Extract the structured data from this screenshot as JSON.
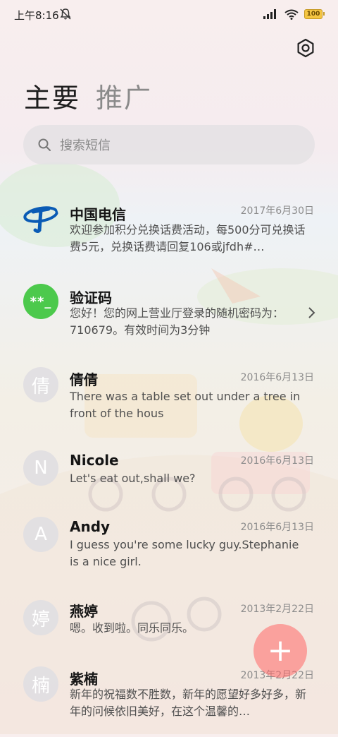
{
  "status_bar": {
    "time": "上午8:16",
    "battery": "100",
    "icons": [
      "bell-off-icon",
      "signal-icon",
      "wifi-icon",
      "battery-icon"
    ]
  },
  "header": {
    "settings_icon": "gear-icon",
    "tabs": [
      {
        "label": "主要",
        "active": true
      },
      {
        "label": "推广",
        "active": false
      }
    ]
  },
  "search": {
    "placeholder": "搜索短信",
    "icon": "search-icon"
  },
  "conversations": [
    {
      "sender": "中国电信",
      "date": "2017年6月30日",
      "preview": "欢迎参加积分兑换话费活动，每500分可兑换话费5元，兑换话费请回复106或jfdh#…",
      "avatar": "china-telecom-logo"
    },
    {
      "sender": "验证码",
      "date": "",
      "preview": "您好！您的网上营业厅登录的随机密码为：710679。有效时间为3分钟",
      "avatar_text": "**_"
    },
    {
      "sender": "倩倩",
      "date": "2016年6月13日",
      "preview": "There was a table set out under a tree in front of the hous",
      "avatar_text": "倩"
    },
    {
      "sender": "Nicole",
      "date": "2016年6月13日",
      "preview": "Let's eat out,shall we?",
      "avatar_text": "N"
    },
    {
      "sender": "Andy",
      "date": "2016年6月13日",
      "preview": "I guess you're some lucky guy.Stephanie is a nice girl.",
      "avatar_text": "A"
    },
    {
      "sender": "燕婷",
      "date": "2013年2月22日",
      "preview": "嗯。收到啦。同乐同乐。",
      "avatar_text": "婷"
    },
    {
      "sender": "紫楠",
      "date": "2013年2月22日",
      "preview": "新年的祝福数不胜数，新年的愿望好多好多，新年的问候依旧美好，在这个温馨的…",
      "avatar_text": "楠"
    }
  ],
  "fab": {
    "label": "+"
  },
  "colors": {
    "verify_avatar": "#4cc94c",
    "fab": "#ff6666",
    "telecom_blue": "#0a5bb5"
  }
}
